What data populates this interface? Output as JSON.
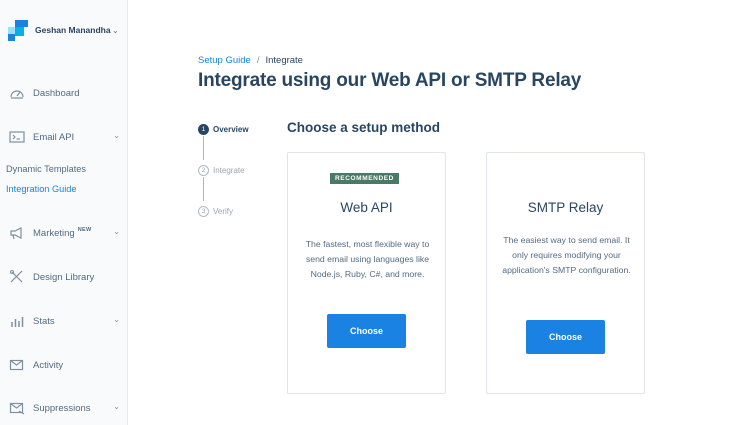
{
  "account": {
    "name": "Geshan Manandhar",
    "chevron": "⌄",
    "logo_icon": "sendgrid-logo"
  },
  "sidebar": {
    "items": [
      {
        "label": "Dashboard",
        "icon": "gauge-icon"
      },
      {
        "label": "Email API",
        "icon": "email-api-icon",
        "chevron": "⌄"
      },
      {
        "label": "Marketing",
        "badge": "NEW",
        "icon": "megaphone-icon",
        "chevron": "⌄"
      },
      {
        "label": "Design Library",
        "icon": "design-tools-icon"
      },
      {
        "label": "Stats",
        "icon": "bar-chart-icon",
        "chevron": "⌄"
      },
      {
        "label": "Activity",
        "icon": "activity-mail-icon"
      },
      {
        "label": "Suppressions",
        "icon": "suppressions-icon",
        "chevron": "⌄"
      }
    ],
    "sub_items": [
      {
        "label": "Dynamic Templates"
      },
      {
        "label": "Integration Guide",
        "active": true
      }
    ]
  },
  "breadcrumb": {
    "parent": "Setup Guide",
    "separator": "/",
    "current": "Integrate"
  },
  "page_title": "Integrate using our Web API or SMTP Relay",
  "stepper": {
    "steps": [
      {
        "number": "1",
        "label": "Overview",
        "active": true
      },
      {
        "number": "2",
        "label": "Integrate"
      },
      {
        "number": "3",
        "label": "Verify"
      }
    ]
  },
  "section_title": "Choose a setup method",
  "cards": [
    {
      "badge": "RECOMMENDED",
      "title": "Web API",
      "description": "The fastest, most flexible way to send email using languages like Node.js, Ruby, C#, and more.",
      "button": "Choose"
    },
    {
      "title": "SMTP Relay",
      "description": "The easiest way to send email. It only requires modifying your application's SMTP configuration.",
      "button": "Choose"
    }
  ],
  "colors": {
    "primary": "#1a82e2",
    "text": "#294661",
    "badge": "#4a7a67",
    "sidebar_bg": "#f9fafb"
  }
}
